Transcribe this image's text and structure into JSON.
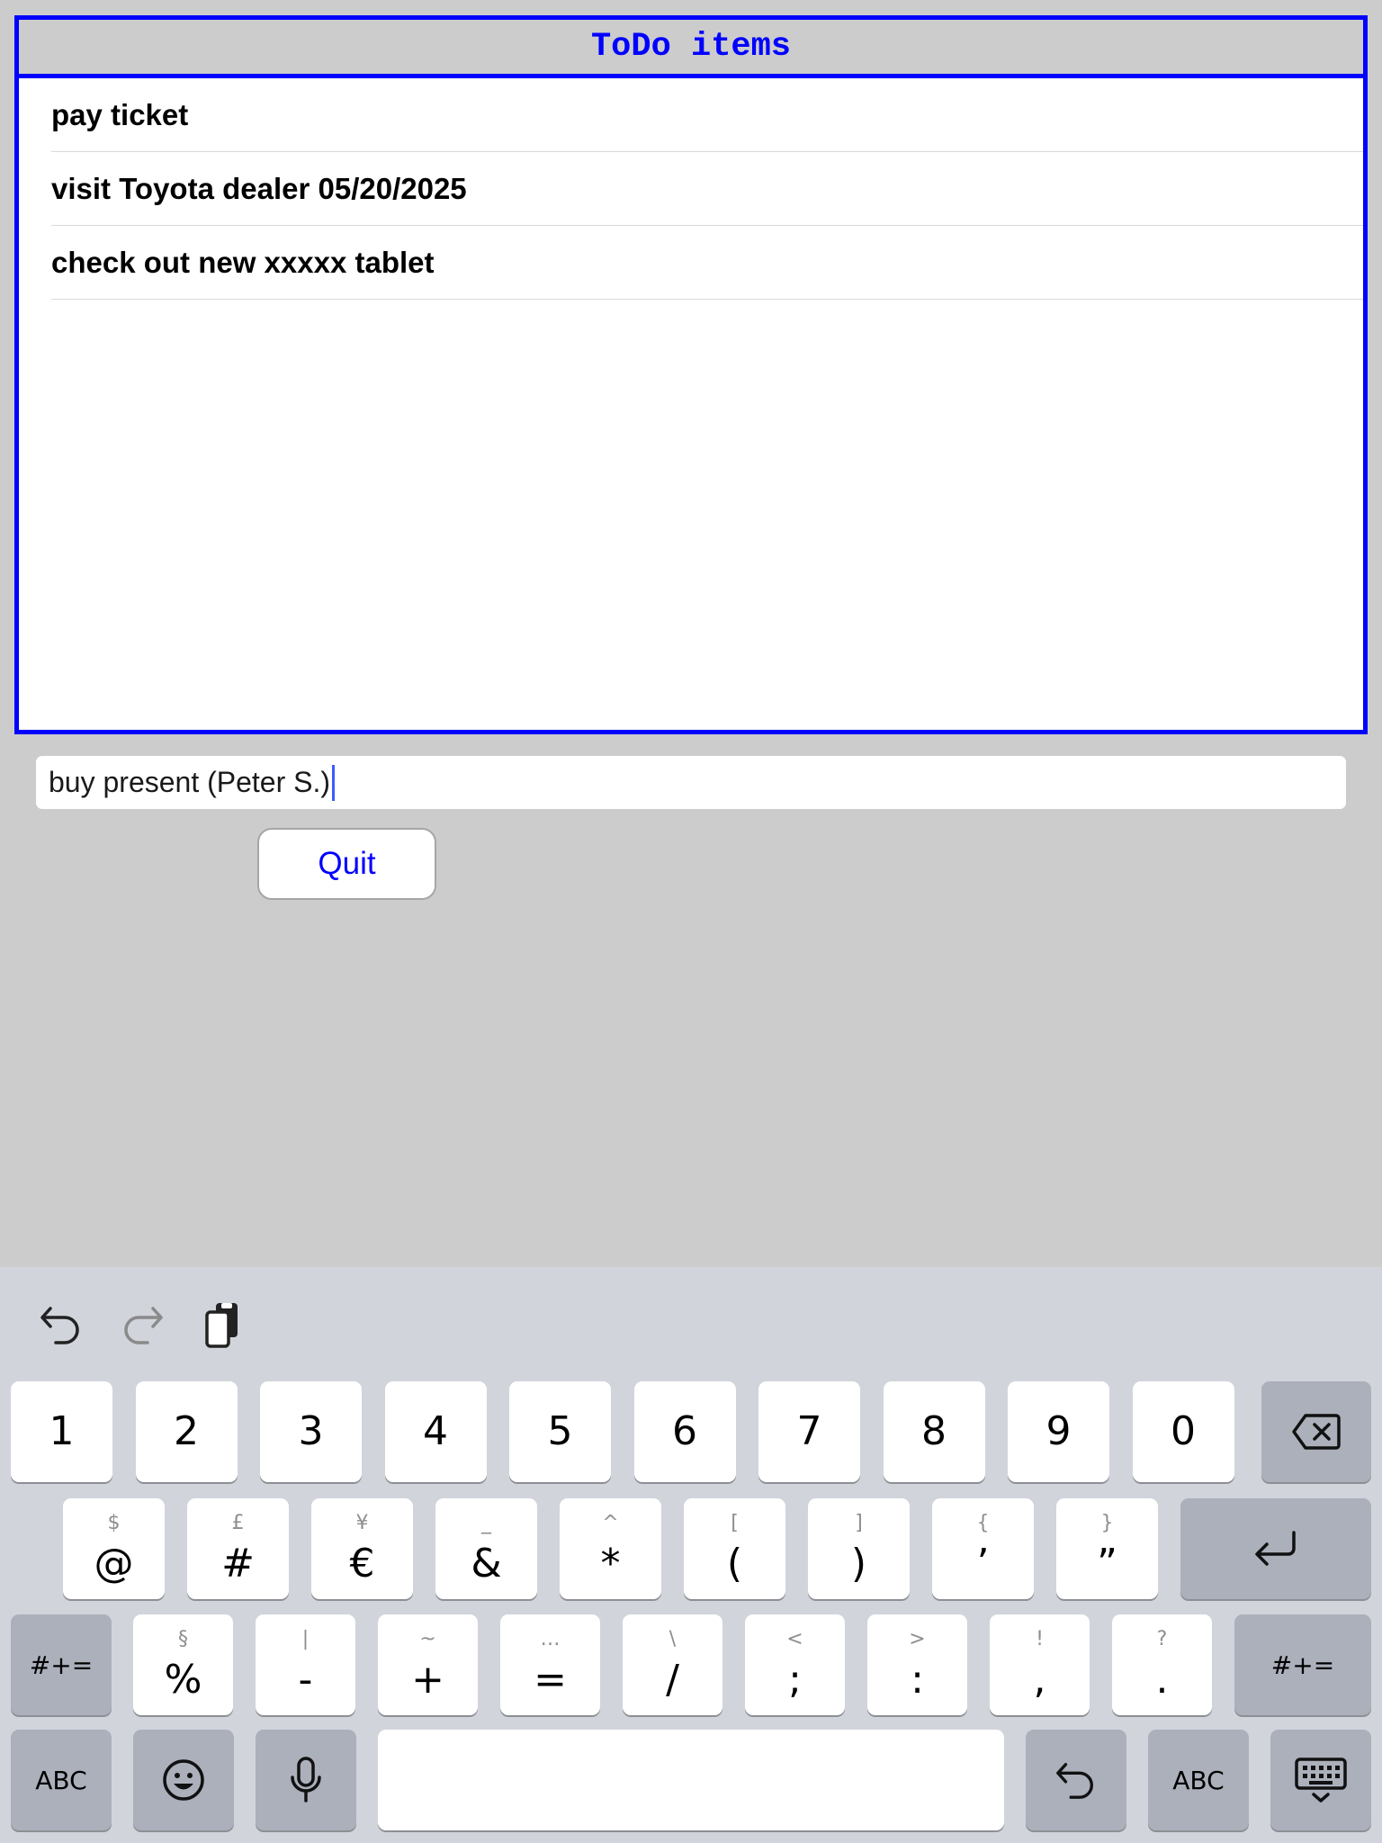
{
  "todo": {
    "title": "ToDo items",
    "items": [
      "pay ticket",
      "visit Toyota dealer 05/20/2025",
      "check out new xxxxx tablet"
    ]
  },
  "input": {
    "value": "buy present (Peter S.)"
  },
  "quit_label": "Quit",
  "colors": {
    "accent": "#0000ff",
    "background": "#cccccc",
    "keyboard_bg": "#d1d4db",
    "dark_key": "#abb0bb"
  },
  "keyboard": {
    "toolbar_icons": [
      "undo-icon",
      "redo-icon",
      "paste-icon"
    ],
    "row1": [
      "1",
      "2",
      "3",
      "4",
      "5",
      "6",
      "7",
      "8",
      "9",
      "0"
    ],
    "row2": [
      {
        "main": "@",
        "alt": "$"
      },
      {
        "main": "#",
        "alt": "£"
      },
      {
        "main": "€",
        "alt": "¥"
      },
      {
        "main": "&",
        "alt": "_"
      },
      {
        "main": "*",
        "alt": "^"
      },
      {
        "main": "(",
        "alt": "["
      },
      {
        "main": ")",
        "alt": "]"
      },
      {
        "main": "’",
        "alt": "{"
      },
      {
        "main": "”",
        "alt": "}"
      }
    ],
    "row3": [
      {
        "main": "%",
        "alt": "§"
      },
      {
        "main": "-",
        "alt": "|"
      },
      {
        "main": "+",
        "alt": "~"
      },
      {
        "main": "=",
        "alt": "…"
      },
      {
        "main": "/",
        "alt": "\\"
      },
      {
        "main": ";",
        "alt": "<"
      },
      {
        "main": ":",
        "alt": ">"
      },
      {
        "main": ",",
        "alt": "!"
      },
      {
        "main": ".",
        "alt": "?"
      }
    ],
    "symbols_label": "#+=",
    "abc_label": "ABC"
  }
}
